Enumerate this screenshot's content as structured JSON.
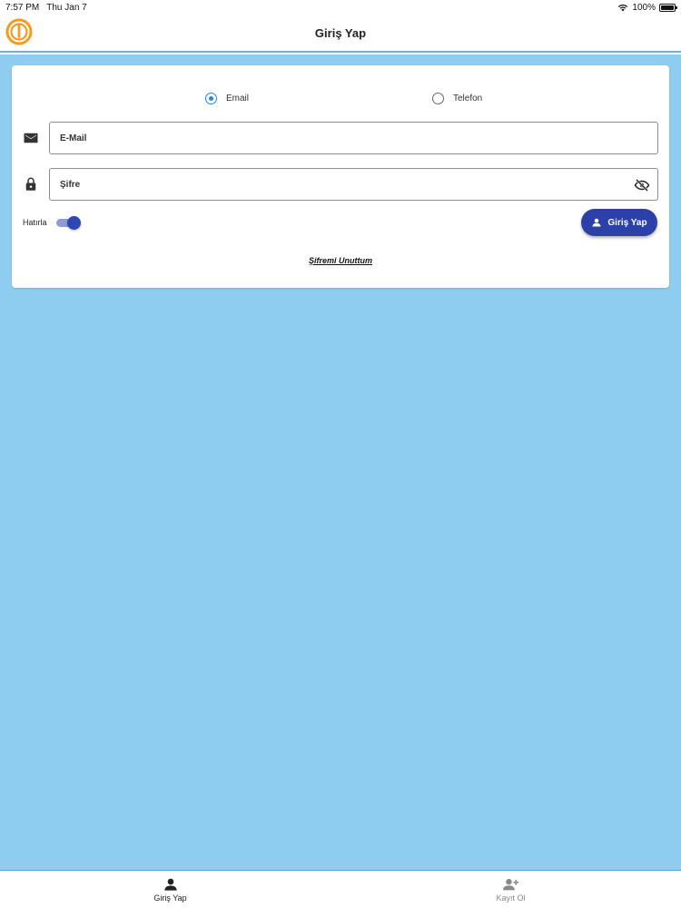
{
  "status_bar": {
    "time": "7:57 PM",
    "date": "Thu Jan 7",
    "battery": "100%"
  },
  "header": {
    "title": "Giriş Yap"
  },
  "login_form": {
    "method_options": [
      {
        "label": "Email",
        "selected": true
      },
      {
        "label": "Telefon",
        "selected": false
      }
    ],
    "email_placeholder": "E-Mail",
    "password_placeholder": "Şifre",
    "remember_label": "Hatırla",
    "remember_on": true,
    "login_button_label": "Giriş Yap",
    "forgot_link": "Şifremi Unuttum"
  },
  "tabbar": {
    "tabs": [
      {
        "label": "Giriş Yap",
        "icon": "person-icon",
        "active": true
      },
      {
        "label": "Kayıt Ol",
        "icon": "person-add-icon",
        "active": false
      }
    ]
  },
  "colors": {
    "background": "#8fcdf0",
    "primary_button": "#2b41a8",
    "radio_accent": "#1e88e5",
    "logo_orange": "#f39c1f"
  }
}
